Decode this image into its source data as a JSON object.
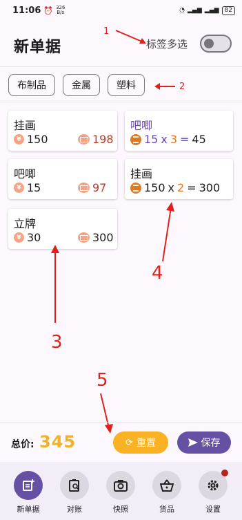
{
  "status_bar": {
    "time": "11:06",
    "net_speed": "326",
    "net_unit": "B/s",
    "battery": "82"
  },
  "header": {
    "title": "新单据",
    "multi_select_label": "标签多选",
    "multi_select_on": false
  },
  "tags": [
    "布制品",
    "金属",
    "塑料"
  ],
  "left_cards": [
    {
      "name": "挂画",
      "price": "150",
      "sell": "198"
    },
    {
      "name": "吧唧",
      "price": "15",
      "sell": "97"
    },
    {
      "name": "立牌",
      "price": "30",
      "sell": "300"
    }
  ],
  "right_cards": [
    {
      "name": "吧唧",
      "price": "15",
      "times": "x",
      "qty": "3",
      "equals": "=",
      "total": "45",
      "highlight": true
    },
    {
      "name": "挂画",
      "price": "150",
      "times": "x",
      "qty": "2",
      "equals": "=",
      "total": "300",
      "highlight": false
    }
  ],
  "annotations": {
    "n1": "1",
    "n2": "2",
    "n3": "3",
    "n4": "4",
    "n5": "5"
  },
  "footer": {
    "total_label": "总价:",
    "total_value": "345",
    "reset_label": "重置",
    "save_label": "保存"
  },
  "nav": [
    {
      "label": "新单据",
      "icon": "new-doc-icon",
      "active": true
    },
    {
      "label": "对账",
      "icon": "clipboard-search-icon",
      "active": false
    },
    {
      "label": "快照",
      "icon": "camera-icon",
      "active": false
    },
    {
      "label": "货品",
      "icon": "basket-icon",
      "active": false
    },
    {
      "label": "设置",
      "icon": "gear-icon",
      "active": false,
      "badge": true
    }
  ],
  "colors": {
    "accent": "#6650a4",
    "total": "#f0b226",
    "reset": "#f8b224",
    "sell": "#b33a2c",
    "annotation": "#e0201b"
  }
}
